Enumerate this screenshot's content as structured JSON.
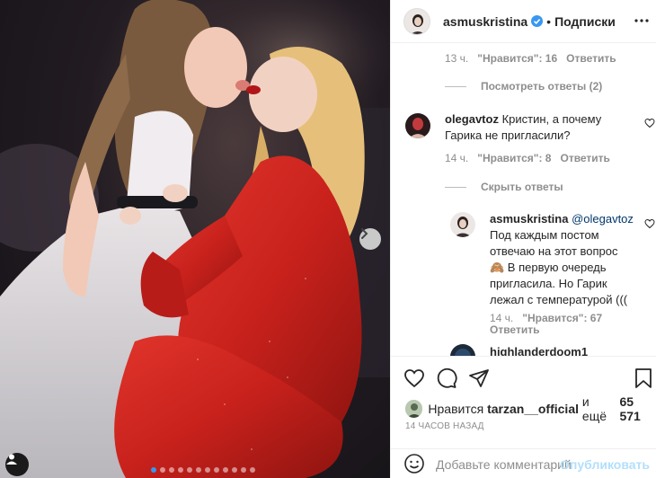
{
  "header": {
    "username": "asmuskristina",
    "separator": "•",
    "follow_label": "Подписки",
    "more_icon": "more-horizontal-icon"
  },
  "photo": {
    "slide_count": 12,
    "active_slide": 1,
    "next_icon": "chevron-right-icon",
    "tag_icon": "person-tag-icon"
  },
  "comments": {
    "first_meta": {
      "time": "13 ч.",
      "likes": "\"Нравится\": 16",
      "reply": "Ответить"
    },
    "view_replies": "Посмотреть ответы (2)",
    "c2": {
      "username": "olegavtoz",
      "line1": "Кристин, а почему",
      "line2": "Гарика не пригласили?",
      "time": "14 ч.",
      "likes": "\"Нравится\": 8",
      "reply": "Ответить"
    },
    "hide_replies": "Скрыть ответы",
    "c3": {
      "username": "asmuskristina",
      "mention": "@olegavtoz",
      "line1": "Под каждым постом",
      "line2": "отвечаю на этот вопрос",
      "line3": "🙈 В первую очередь",
      "line4": "пригласила. Но Гарик",
      "line5": "лежал с температурой (((",
      "time": "14 ч.",
      "likes": "\"Нравится\": 67",
      "reply": "Ответить"
    },
    "c4": {
      "username": "highlanderdoom1"
    }
  },
  "actions": {
    "like_icon": "heart-icon",
    "comment_icon": "comment-icon",
    "share_icon": "share-icon",
    "save_icon": "bookmark-icon",
    "likes_prefix": "Нравится",
    "likes_user": "tarzan__official",
    "likes_mid": "и ещё",
    "likes_count": "65 571",
    "timestamp": "14 ЧАСОВ НАЗАД",
    "emoji_icon": "smiley-icon",
    "comment_placeholder": "Добавьте комментарий...",
    "publish_label": "Опубликовать"
  },
  "colors": {
    "accent": "#3897f0",
    "publish_disabled": "#b2dffc",
    "muted": "#8e8e8e",
    "dress_red": "#c8211c"
  }
}
